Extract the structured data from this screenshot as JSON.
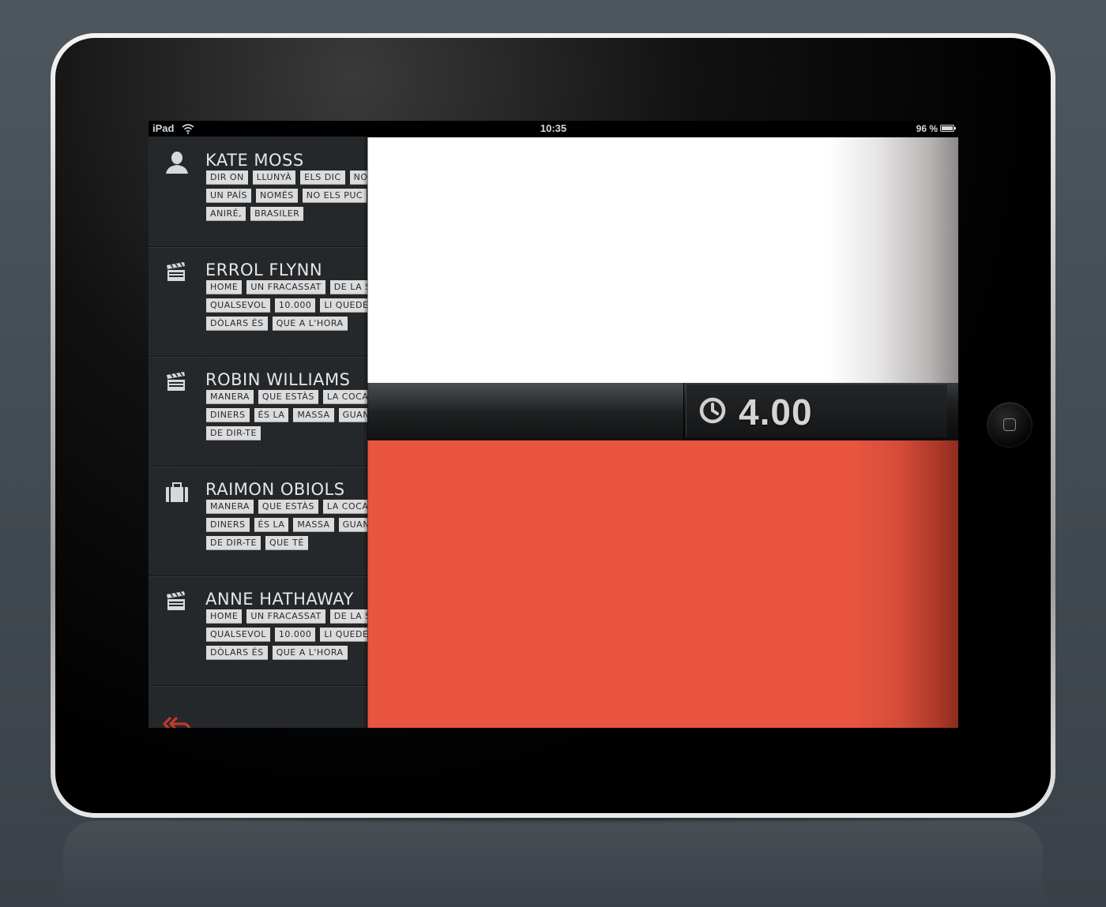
{
  "status_bar": {
    "carrier": "iPad",
    "time": "10:35",
    "battery": "96 %"
  },
  "contacts": [
    {
      "name": "KATE MOSS",
      "icon": "person-icon",
      "tag_rows": [
        [
          "DIR ON",
          "LLUNYÀ",
          "ELS DIC",
          "NO"
        ],
        [
          "UN PAÍS",
          "NOMÉS",
          "NO ELS PUC"
        ],
        [
          "ANIRÉ,",
          "BRASILER"
        ]
      ]
    },
    {
      "name": "ERROL FLYNN",
      "icon": "clapperboard-icon",
      "tag_rows": [
        [
          "HOME",
          "UN FRACASSAT",
          "DE LA SE"
        ],
        [
          "QUALSEVOL",
          "10.000",
          "LI QUEDEN"
        ],
        [
          "DÒLARS ÉS",
          "QUE A L'HORA"
        ]
      ]
    },
    {
      "name": "ROBIN WILLIAMS",
      "icon": "clapperboard-icon",
      "tag_rows": [
        [
          "MANERA",
          "QUE ESTÀS",
          "LA COCAÏ"
        ],
        [
          "DINERS",
          "ÉS LA",
          "MASSA",
          "GUAN"
        ],
        [
          "DE DIR-TE"
        ]
      ]
    },
    {
      "name": "RAIMON OBIOLS",
      "icon": "briefcase-icon",
      "tag_rows": [
        [
          "MANERA",
          "QUE ESTÀS",
          "LA COCAÏ"
        ],
        [
          "DINERS",
          "ÉS LA",
          "MASSA",
          "GUAN"
        ],
        [
          "DE DIR-TE",
          "QUE TÉ"
        ]
      ]
    },
    {
      "name": "ANNE HATHAWAY",
      "icon": "clapperboard-icon",
      "tag_rows": [
        [
          "HOME",
          "UN FRACASSAT",
          "DE LA SE"
        ],
        [
          "QUALSEVOL",
          "10.000",
          "LI QUEDEN"
        ],
        [
          "DÒLARS ÉS",
          "QUE A L'HORA"
        ]
      ]
    }
  ],
  "timer": {
    "value": "4.00",
    "icon": "clock-icon"
  },
  "colors": {
    "accent_red": "#e95540",
    "back_arrow": "#c0392b",
    "sidebar_bg": "#25282b",
    "tag_bg": "#dcdcdc"
  },
  "footer": {
    "back_icon": "double-back-arrow-icon"
  }
}
